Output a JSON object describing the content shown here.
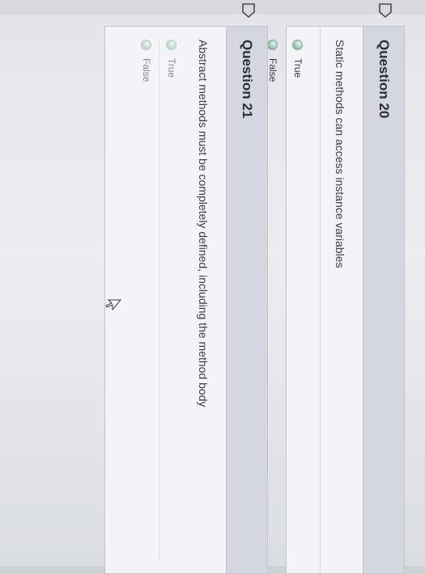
{
  "questions": [
    {
      "title": "Question 20",
      "text": "Static methods can access instance variables",
      "answers": [
        "True",
        "False"
      ]
    },
    {
      "title": "Question 21",
      "text": "Abstract methods must be completely defined, including the method body",
      "answers": [
        "True",
        "False"
      ]
    }
  ],
  "colors": {
    "header_bg": "#d5d6e0",
    "radio": "#9cc7b1"
  }
}
